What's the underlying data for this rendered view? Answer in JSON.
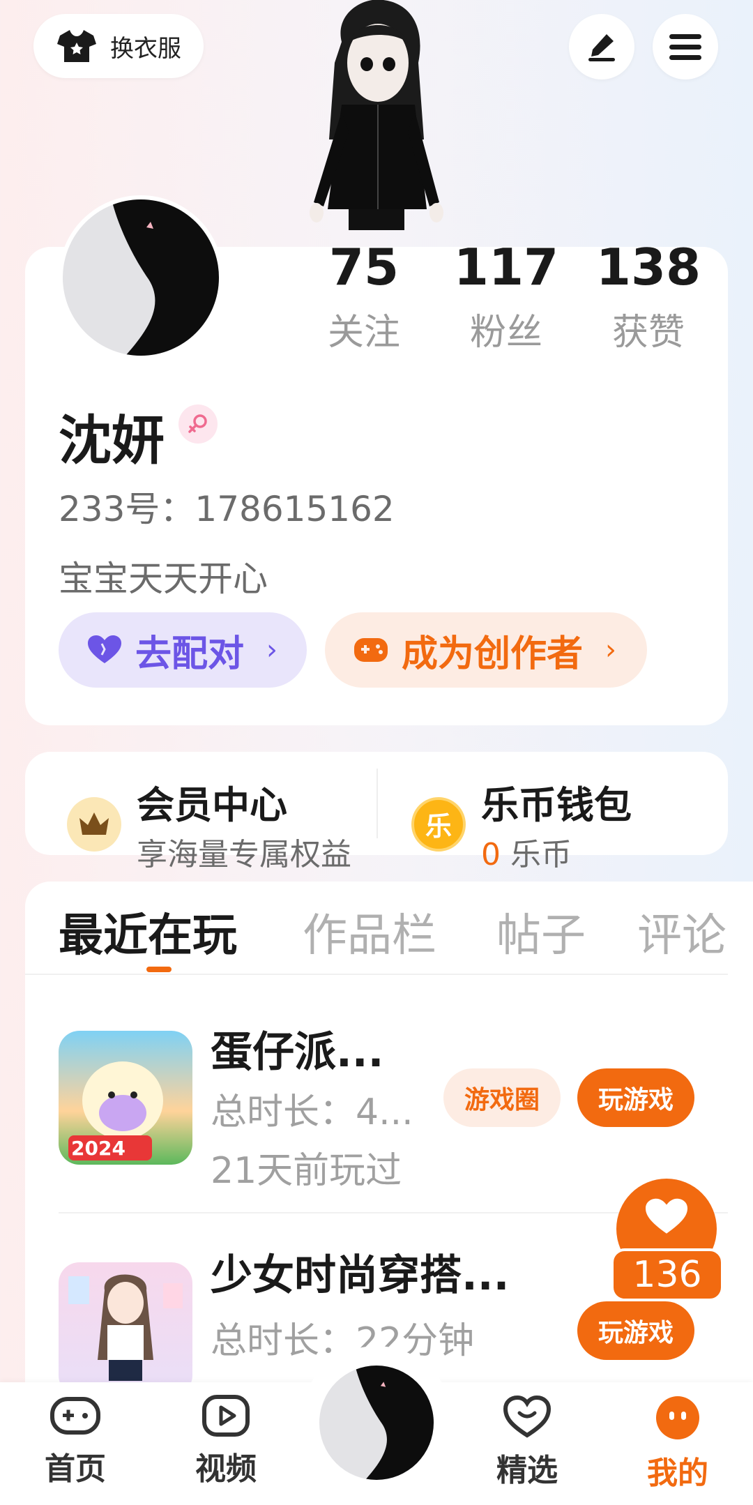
{
  "topbar": {
    "outfit_label": "换衣服",
    "icons": {
      "outfit": "tshirt-icon",
      "edit": "pen-icon",
      "menu": "menu-icon"
    }
  },
  "profile": {
    "stats": [
      {
        "value": "75",
        "label": "关注"
      },
      {
        "value": "117",
        "label": "粉丝"
      },
      {
        "value": "138",
        "label": "获赞"
      }
    ],
    "name": "沈妍",
    "gender": "female",
    "id_text": "233号：178615162",
    "bio": "宝宝天天开心",
    "match_label": "去配对",
    "creator_label": "成为创作者",
    "chevron": "›"
  },
  "member": {
    "title": "会员中心",
    "subtitle": "享海量专属权益"
  },
  "wallet": {
    "title": "乐币钱包",
    "coin_glyph": "乐",
    "count": "0",
    "unit": "乐币"
  },
  "tabs": [
    {
      "label": "最近在玩",
      "active": true
    },
    {
      "label": "作品栏",
      "active": false
    },
    {
      "label": "帖子",
      "active": false
    },
    {
      "label": "评论",
      "active": false
    }
  ],
  "games": [
    {
      "title": "蛋仔派...",
      "duration": "总时长：4...",
      "last_played": "21天前玩过",
      "circle_label": "游戏圈",
      "play_label": "玩游戏",
      "badge_text": "2024"
    },
    {
      "title": "少女时尚穿搭...",
      "duration": "总时长：22分钟",
      "play_label": "玩游戏"
    }
  ],
  "like_float": {
    "count": "136"
  },
  "bottom_nav": [
    {
      "label": "首页",
      "icon": "gamepad-icon",
      "active": false
    },
    {
      "label": "视频",
      "icon": "video-play-icon",
      "active": false
    },
    {
      "label": "精选",
      "icon": "heart-chat-icon",
      "active": false
    },
    {
      "label": "我的",
      "icon": "face-icon",
      "active": true
    }
  ],
  "colors": {
    "accent": "#f26a10",
    "purple": "#6c55e6",
    "muted": "#9a9a9a"
  }
}
